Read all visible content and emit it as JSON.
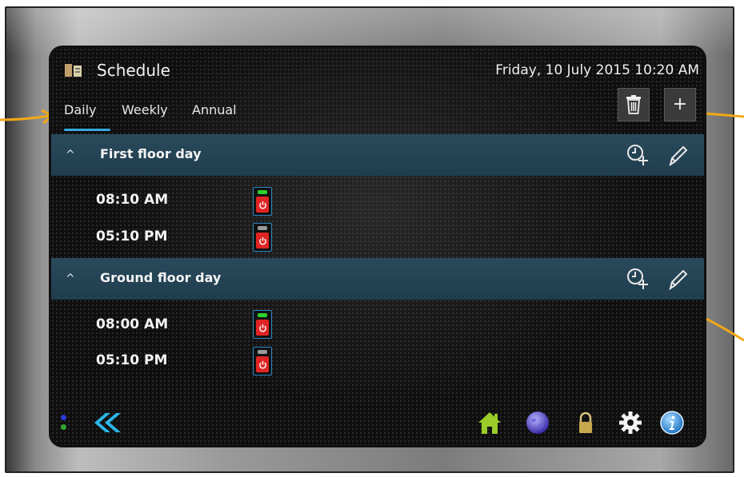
{
  "header": {
    "app_title": "Schedule",
    "datetime": "Friday, 10 July 2015 10:20 AM"
  },
  "tabs": [
    {
      "label": "Daily",
      "active": true
    },
    {
      "label": "Weekly",
      "active": false
    },
    {
      "label": "Annual",
      "active": false
    }
  ],
  "toolbar": {
    "delete_icon": "trash-icon",
    "add_label": "+"
  },
  "schedules": [
    {
      "title": "First floor day",
      "expand_glyph": "^",
      "entries": [
        {
          "time": "08:10 AM",
          "state": "on"
        },
        {
          "time": "05:10 PM",
          "state": "off"
        }
      ]
    },
    {
      "title": "Ground floor day",
      "expand_glyph": "^",
      "entries": [
        {
          "time": "08:00 AM",
          "state": "on"
        },
        {
          "time": "05:10 PM",
          "state": "off"
        }
      ]
    }
  ],
  "bottom_nav": {
    "back_icon": "double-chevron-left-icon",
    "items": [
      "home-icon",
      "globe-icon",
      "lock-icon",
      "gear-icon",
      "info-icon"
    ]
  },
  "colors": {
    "accent": "#3aa9e0",
    "section_bar": "#244456",
    "led_on": "#2fd12f",
    "led_off": "#9a9a9a",
    "power_red": "#e02424",
    "annotation_arrow": "#f2a818"
  }
}
